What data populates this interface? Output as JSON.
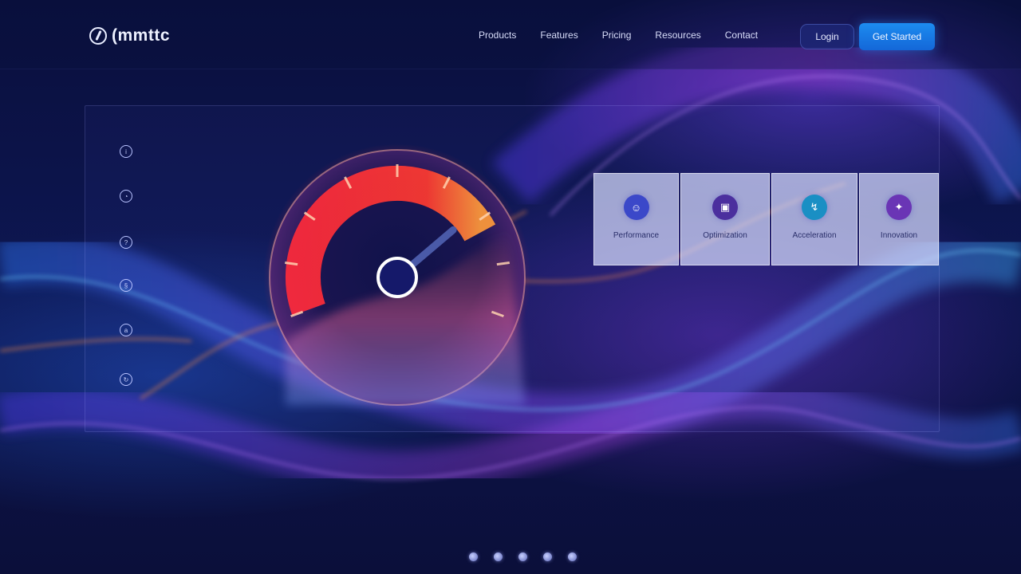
{
  "brand": {
    "logo_text": "(mmttc",
    "logo_icon": "bolt-circle-icon"
  },
  "nav": {
    "links": [
      {
        "label": "Products"
      },
      {
        "label": "Features"
      },
      {
        "label": "Pricing"
      },
      {
        "label": "Resources"
      },
      {
        "label": "Contact"
      }
    ],
    "login_label": "Login",
    "cta_label": "Get Started"
  },
  "side_icons": [
    {
      "icon": "info-icon",
      "glyph": "i"
    },
    {
      "icon": "headset-icon",
      "glyph": "◔"
    },
    {
      "icon": "help-icon",
      "glyph": "?"
    },
    {
      "icon": "settings-icon",
      "glyph": "§"
    },
    {
      "icon": "lock-icon",
      "glyph": "a"
    },
    {
      "icon": "refresh-icon",
      "glyph": "↻"
    }
  ],
  "gauge": {
    "level": 0.78
  },
  "cards": [
    {
      "label": "Performance",
      "icon": "speed-icon",
      "color": "#3b48c9",
      "glyph": "☺"
    },
    {
      "label": "Optimization",
      "icon": "chart-icon",
      "color": "#4b2f9e",
      "glyph": "▣"
    },
    {
      "label": "Acceleration",
      "icon": "bolt-icon",
      "color": "#1a8fc4",
      "glyph": "↯"
    },
    {
      "label": "Innovation",
      "icon": "spark-icon",
      "color": "#6a35b5",
      "glyph": "✦"
    }
  ],
  "pagination": {
    "count": 5,
    "active": 1
  },
  "theme": {
    "accent": "#1c8cf0",
    "gauge_red": "#ff2a3a",
    "gauge_orange": "#ff9a3a"
  }
}
